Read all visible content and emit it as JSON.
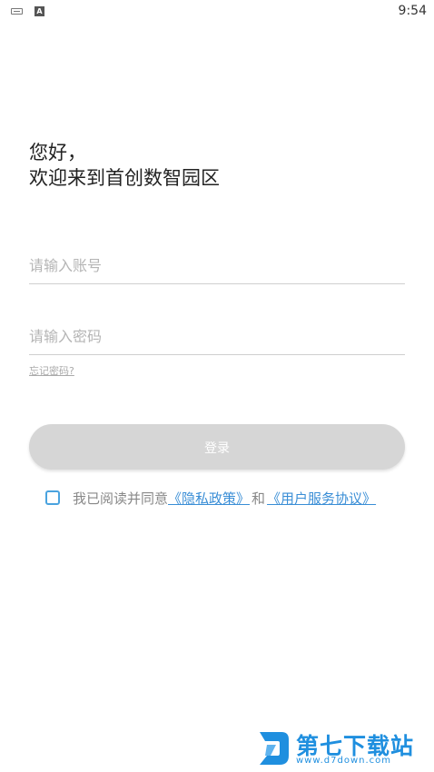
{
  "status_bar": {
    "time": "9:54",
    "app_icon_letter": "A"
  },
  "greeting": {
    "line1": "您好，",
    "line2": "欢迎来到首创数智园区"
  },
  "form": {
    "account_placeholder": "请输入账号",
    "password_placeholder": "请输入密码",
    "account_value": "",
    "password_value": "",
    "forgot_label": "忘记密码?",
    "login_label": "登录"
  },
  "agreement": {
    "checked": false,
    "prefix": "我已阅读并同意",
    "privacy_link": "《隐私政策》",
    "and_text": "和",
    "terms_link": "《用户服务协议》"
  },
  "watermark": {
    "title": "第七下载站",
    "url": "www.d7down.com",
    "color": "#1f8fdf"
  },
  "colors": {
    "accent": "#4aa3df",
    "link": "#3a8ed6",
    "button_disabled": "#d6d6d6"
  }
}
